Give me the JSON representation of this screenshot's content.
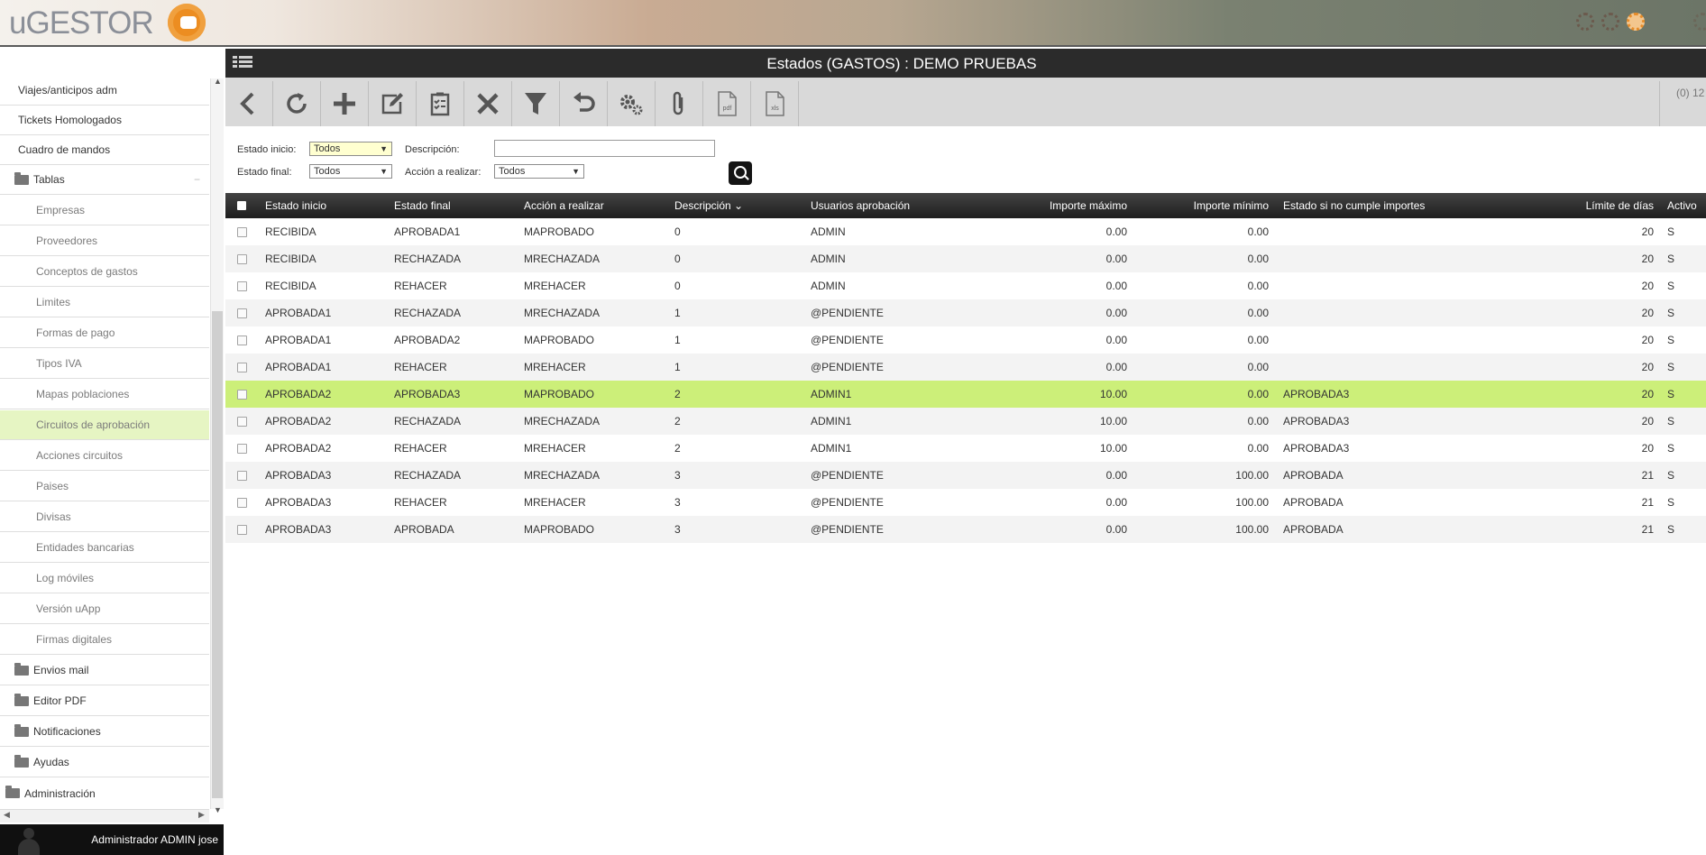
{
  "app": {
    "logo_text": "uGESTOR"
  },
  "sidebar": {
    "items": [
      {
        "label": "Viajes/anticipos adm"
      },
      {
        "label": "Tickets Homologados"
      },
      {
        "label": "Cuadro de mandos"
      },
      {
        "label": "Tablas",
        "collapse": "−"
      },
      {
        "label": "Empresas"
      },
      {
        "label": "Proveedores"
      },
      {
        "label": "Conceptos de gastos"
      },
      {
        "label": "Limites"
      },
      {
        "label": "Formas de pago"
      },
      {
        "label": "Tipos IVA"
      },
      {
        "label": "Mapas poblaciones"
      },
      {
        "label": "Circuitos de aprobación"
      },
      {
        "label": "Acciones circuitos"
      },
      {
        "label": "Paises"
      },
      {
        "label": "Divisas"
      },
      {
        "label": "Entidades bancarias"
      },
      {
        "label": "Log móviles"
      },
      {
        "label": "Versión uApp"
      },
      {
        "label": "Firmas digitales"
      },
      {
        "label": "Envios mail"
      },
      {
        "label": "Editor PDF"
      },
      {
        "label": "Notificaciones"
      },
      {
        "label": "Ayudas"
      },
      {
        "label": "Administración"
      }
    ],
    "active_item": "Circuitos de aprobación",
    "user_label": "Administrador ADMIN jose"
  },
  "main": {
    "title": "Estados (GASTOS) : DEMO PRUEBAS",
    "record_count": "(0) 12",
    "toolbar": [
      {
        "name": "back",
        "icon": "chevron-left-icon"
      },
      {
        "name": "refresh",
        "icon": "refresh-icon"
      },
      {
        "name": "add",
        "icon": "plus-icon"
      },
      {
        "name": "edit",
        "icon": "edit-icon"
      },
      {
        "name": "clipboard",
        "icon": "clipboard-check-icon"
      },
      {
        "name": "delete",
        "icon": "close-icon"
      },
      {
        "name": "filter",
        "icon": "filter-icon"
      },
      {
        "name": "undo",
        "icon": "undo-icon"
      },
      {
        "name": "settings",
        "icon": "gears-icon"
      },
      {
        "name": "attach",
        "icon": "paperclip-icon"
      },
      {
        "name": "export-pdf",
        "icon": "pdf-file-icon",
        "label": "pdf"
      },
      {
        "name": "export-xls",
        "icon": "xls-file-icon",
        "label": "xls"
      }
    ],
    "filters": {
      "estado_inicio_label": "Estado inicio:",
      "estado_inicio_value": "Todos",
      "estado_final_label": "Estado final:",
      "estado_final_value": "Todos",
      "descripcion_label": "Descripción:",
      "descripcion_value": "",
      "accion_label": "Acción a realizar:",
      "accion_value": "Todos"
    },
    "table": {
      "headers": [
        "Estado inicio",
        "Estado final",
        "Acción a realizar",
        "Descripción",
        "Usuarios aprobación",
        "Importe máximo",
        "Importe mínimo",
        "Estado si no cumple importes",
        "Límite de días",
        "Activo"
      ],
      "sort_indicator": "⌄",
      "rows": [
        [
          "RECIBIDA",
          "APROBADA1",
          "MAPROBADO",
          "0",
          "ADMIN",
          "0.00",
          "0.00",
          "",
          "20",
          "S"
        ],
        [
          "RECIBIDA",
          "RECHAZADA",
          "MRECHAZADA",
          "0",
          "ADMIN",
          "0.00",
          "0.00",
          "",
          "20",
          "S"
        ],
        [
          "RECIBIDA",
          "REHACER",
          "MREHACER",
          "0",
          "ADMIN",
          "0.00",
          "0.00",
          "",
          "20",
          "S"
        ],
        [
          "APROBADA1",
          "RECHAZADA",
          "MRECHAZADA",
          "1",
          "@PENDIENTE",
          "0.00",
          "0.00",
          "",
          "20",
          "S"
        ],
        [
          "APROBADA1",
          "APROBADA2",
          "MAPROBADO",
          "1",
          "@PENDIENTE",
          "0.00",
          "0.00",
          "",
          "20",
          "S"
        ],
        [
          "APROBADA1",
          "REHACER",
          "MREHACER",
          "1",
          "@PENDIENTE",
          "0.00",
          "0.00",
          "",
          "20",
          "S"
        ],
        [
          "APROBADA2",
          "APROBADA3",
          "MAPROBADO",
          "2",
          "ADMIN1",
          "10.00",
          "0.00",
          "APROBADA3",
          "20",
          "S"
        ],
        [
          "APROBADA2",
          "RECHAZADA",
          "MRECHAZADA",
          "2",
          "ADMIN1",
          "10.00",
          "0.00",
          "APROBADA3",
          "20",
          "S"
        ],
        [
          "APROBADA2",
          "REHACER",
          "MREHACER",
          "2",
          "ADMIN1",
          "10.00",
          "0.00",
          "APROBADA3",
          "20",
          "S"
        ],
        [
          "APROBADA3",
          "RECHAZADA",
          "MRECHAZADA",
          "3",
          "@PENDIENTE",
          "0.00",
          "100.00",
          "APROBADA",
          "21",
          "S"
        ],
        [
          "APROBADA3",
          "REHACER",
          "MREHACER",
          "3",
          "@PENDIENTE",
          "0.00",
          "100.00",
          "APROBADA",
          "21",
          "S"
        ],
        [
          "APROBADA3",
          "APROBADA",
          "MAPROBADO",
          "3",
          "@PENDIENTE",
          "0.00",
          "100.00",
          "APROBADA",
          "21",
          "S"
        ]
      ],
      "selected_row_index": 6
    }
  },
  "colors": {
    "accent": "#ec8d21",
    "selected_row": "#ccef79",
    "active_menu": "#e6f5c3",
    "title_bar": "#2b2b2b"
  }
}
